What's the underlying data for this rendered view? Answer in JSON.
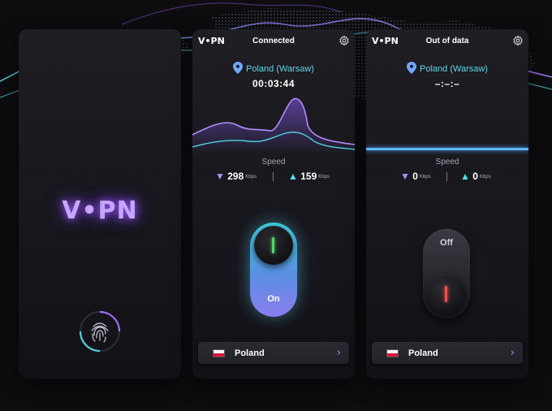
{
  "brand": {
    "logo_text": "V•PN",
    "accent": "#9b5cff",
    "cyan": "#4fd3e3"
  },
  "splash": {
    "logo": "V•PN",
    "icon": "fingerprint-icon"
  },
  "connected_screen": {
    "logo": "V•PN",
    "status": "Connected",
    "location": "Poland (Warsaw)",
    "timer": "00:03:44",
    "speed_label": "Speed",
    "download": {
      "value": "298",
      "unit": "Kbps",
      "arrow": "▼"
    },
    "upload": {
      "value": "159",
      "unit": "Kbps",
      "arrow": "▲"
    },
    "toggle_label": "On",
    "country": "Poland"
  },
  "out_of_data_screen": {
    "logo": "V•PN",
    "status": "Out of data",
    "location": "Poland (Warsaw)",
    "timer": "–:–:–",
    "speed_label": "Speed",
    "download": {
      "value": "0",
      "unit": "Kbps",
      "arrow": "▼"
    },
    "upload": {
      "value": "0",
      "unit": "Kbps",
      "arrow": "▲"
    },
    "toggle_label": "Off",
    "country": "Poland"
  },
  "icons": [
    "gear-icon",
    "location-pin-icon",
    "fingerprint-icon",
    "chevron-right-icon",
    "flag-poland-icon"
  ]
}
